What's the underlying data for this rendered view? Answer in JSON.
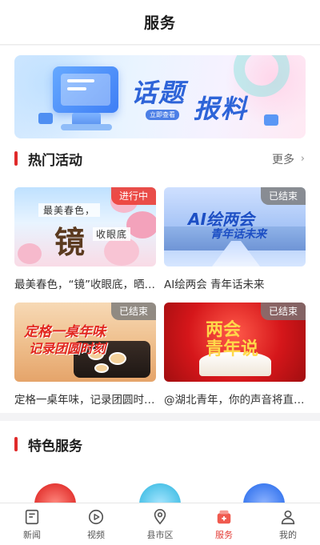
{
  "header": {
    "title": "服务"
  },
  "banner": {
    "title_part1": "话题",
    "title_part2": "报料",
    "subtitle": "立即查看"
  },
  "hot_activities": {
    "title": "热门活动",
    "more_label": "更多",
    "cards": [
      {
        "caption": "最美春色，“镜”收眼底，晒…",
        "status": "进行中",
        "thumb_text": [
          "最美春色，",
          "镜",
          "收眼底"
        ]
      },
      {
        "caption": "AI绘两会 青年话未来",
        "status": "已结束",
        "thumb_text": [
          "AI绘两会",
          "青年话未来"
        ]
      },
      {
        "caption": "定格一桌年味，记录团圆时…",
        "status": "已结束",
        "thumb_text": [
          "定格一桌年味",
          "记录团圆时刻"
        ]
      },
      {
        "caption": "@湖北青年，你的声音将直…",
        "status": "已结束",
        "thumb_text": [
          "两会",
          "青年说"
        ]
      }
    ]
  },
  "featured_services": {
    "title": "特色服务"
  },
  "colors": {
    "accent": "#e02a2a",
    "live_badge": "#ec403a",
    "ended_badge": "#787878"
  },
  "tabbar": {
    "items": [
      {
        "label": "新闻",
        "icon": "news-icon",
        "active": false
      },
      {
        "label": "视频",
        "icon": "video-icon",
        "active": false
      },
      {
        "label": "县市区",
        "icon": "location-icon",
        "active": false
      },
      {
        "label": "服务",
        "icon": "service-icon",
        "active": true
      },
      {
        "label": "我的",
        "icon": "profile-icon",
        "active": false
      }
    ]
  }
}
